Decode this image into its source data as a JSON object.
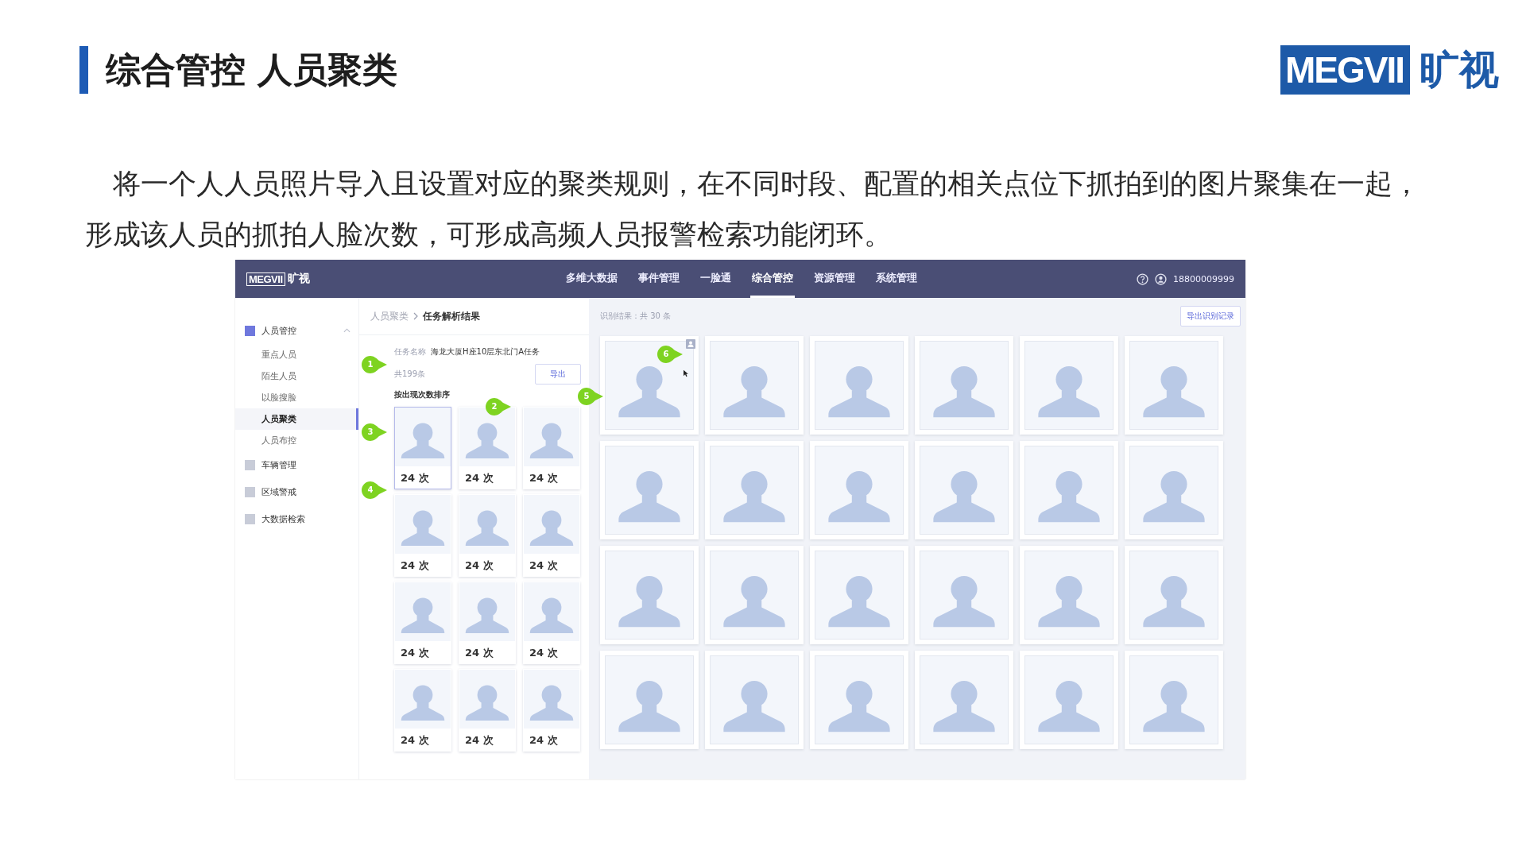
{
  "slide": {
    "title": "综合管控 人员聚类",
    "logo": {
      "wordmark": "MEGVII",
      "name": "旷视"
    },
    "description": "将一个人人员照片导入且设置对应的聚类规则，在不同时段、配置的相关点位下抓拍到的图片聚集在一起，形成该人员的抓拍人脸次数，可形成高频人员报警检索功能闭环。"
  },
  "screenshot": {
    "topbar": {
      "logo": {
        "wordmark": "MEGVII",
        "name": "旷视"
      },
      "nav": [
        {
          "label": "多维大数据",
          "selected": false
        },
        {
          "label": "事件管理",
          "selected": false
        },
        {
          "label": "一脸通",
          "selected": false
        },
        {
          "label": "综合管控",
          "selected": true
        },
        {
          "label": "资源管理",
          "selected": false
        },
        {
          "label": "系统管理",
          "selected": false
        }
      ],
      "user": "18800009999"
    },
    "sidebar": {
      "groups": [
        {
          "label": "人员管控",
          "active": true,
          "expanded": true,
          "children": [
            {
              "label": "重点人员",
              "selected": false
            },
            {
              "label": "陌生人员",
              "selected": false
            },
            {
              "label": "以脸搜脸",
              "selected": false
            },
            {
              "label": "人员聚类",
              "selected": true
            },
            {
              "label": "人员布控",
              "selected": false
            }
          ]
        },
        {
          "label": "车辆管理",
          "active": false,
          "expanded": false
        },
        {
          "label": "区域警戒",
          "active": false,
          "expanded": false
        },
        {
          "label": "大数据检索",
          "active": false,
          "expanded": false
        }
      ]
    },
    "middle": {
      "breadcrumb": [
        "人员聚类",
        "任务解析结果"
      ],
      "task_label": "任务名称",
      "task_name": "海龙大厦H座10层东北门A任务",
      "total": "共199条",
      "export_button": "导出",
      "sort_label": "按出现次数排序",
      "clusters": [
        {
          "count": "24 次",
          "selected": true
        },
        {
          "count": "24 次",
          "selected": false
        },
        {
          "count": "24 次",
          "selected": false
        },
        {
          "count": "24 次",
          "selected": false
        },
        {
          "count": "24 次",
          "selected": false
        },
        {
          "count": "24 次",
          "selected": false
        },
        {
          "count": "24 次",
          "selected": false
        },
        {
          "count": "24 次",
          "selected": false
        },
        {
          "count": "24 次",
          "selected": false
        },
        {
          "count": "24 次",
          "selected": false
        },
        {
          "count": "24 次",
          "selected": false
        },
        {
          "count": "24 次",
          "selected": false
        }
      ]
    },
    "results": {
      "summary": "识别结果：共 30 条",
      "export_button": "导出识别记录",
      "photos": [
        {
          "hovered": true
        },
        {
          "hovered": false
        },
        {
          "hovered": false
        },
        {
          "hovered": false
        },
        {
          "hovered": false
        },
        {
          "hovered": false
        },
        {
          "hovered": false
        },
        {
          "hovered": false
        },
        {
          "hovered": false
        },
        {
          "hovered": false
        },
        {
          "hovered": false
        },
        {
          "hovered": false
        },
        {
          "hovered": false
        },
        {
          "hovered": false
        },
        {
          "hovered": false
        },
        {
          "hovered": false
        },
        {
          "hovered": false
        },
        {
          "hovered": false
        },
        {
          "hovered": false
        },
        {
          "hovered": false
        },
        {
          "hovered": false
        },
        {
          "hovered": false
        },
        {
          "hovered": false
        },
        {
          "hovered": false
        }
      ]
    },
    "callouts": [
      "1",
      "2",
      "3",
      "4",
      "5",
      "6"
    ]
  }
}
